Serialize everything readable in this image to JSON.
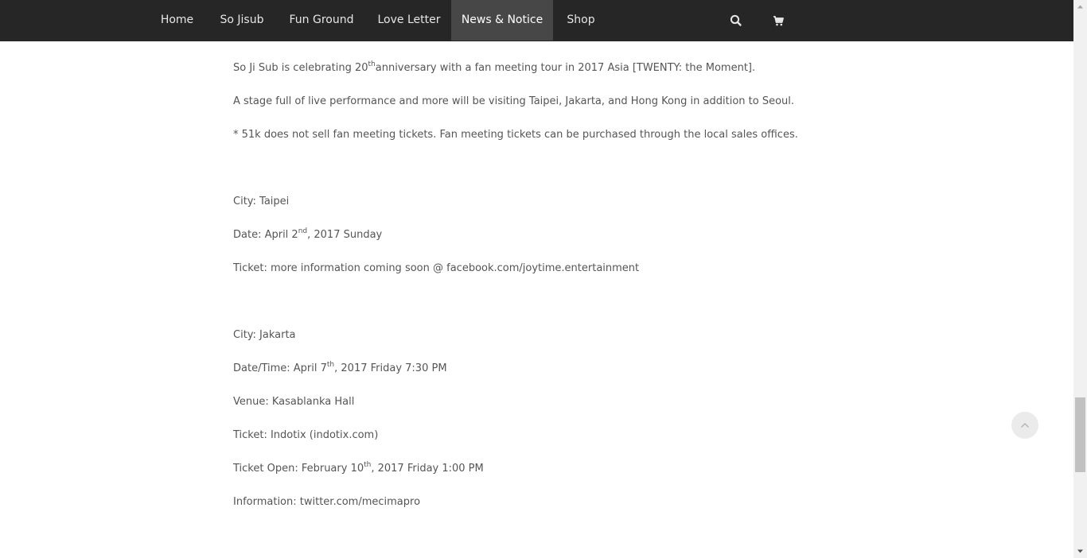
{
  "nav": {
    "items": [
      "Home",
      "So Jisub",
      "Fun Ground",
      "Love Letter",
      "News & Notice",
      "Shop"
    ],
    "active": "News & Notice",
    "search_icon": "search-icon",
    "cart_icon": "shopping-cart-icon"
  },
  "content": {
    "intro": {
      "pre": "So Ji Sub is celebrating 20",
      "sup": "th",
      "post": "anniversary with a fan meeting tour in 2017 Asia [TWENTY: the Moment]."
    },
    "stage": "A stage full of live performance and more will be visiting Taipei, Jakarta, and Hong Kong in addition to Seoul.",
    "notice": "* 51k does not sell fan meeting tickets. Fan meeting tickets can be purchased through the local sales offices.",
    "taipei": {
      "city": "City: Taipei",
      "date_pre": "Date: April 2",
      "date_sup": "nd",
      "date_post": ", 2017 Sunday",
      "ticket": "Ticket: more information coming soon @ facebook.com/joytime.entertainment"
    },
    "jakarta": {
      "city": "City: Jakarta",
      "datetime_pre": "Date/Time: April 7",
      "datetime_sup": "th",
      "datetime_post": ", 2017 Friday 7:30 PM",
      "venue": "Venue: Kasablanka Hall",
      "ticket": "Ticket: Indotix (indotix.com)",
      "open_pre": "Ticket Open: February 10",
      "open_sup": "th",
      "open_post": ", 2017 Friday 1:00 PM",
      "information": "Information: twitter.com/mecimapro"
    }
  },
  "colors": {
    "nav_background": "#262626",
    "nav_active_background": "#474747",
    "text": "#555555"
  },
  "icons": {
    "scroll_top": "chevron-up-icon",
    "scroll_up": "scroll-up-arrow-icon",
    "scroll_down": "scroll-down-arrow-icon"
  }
}
